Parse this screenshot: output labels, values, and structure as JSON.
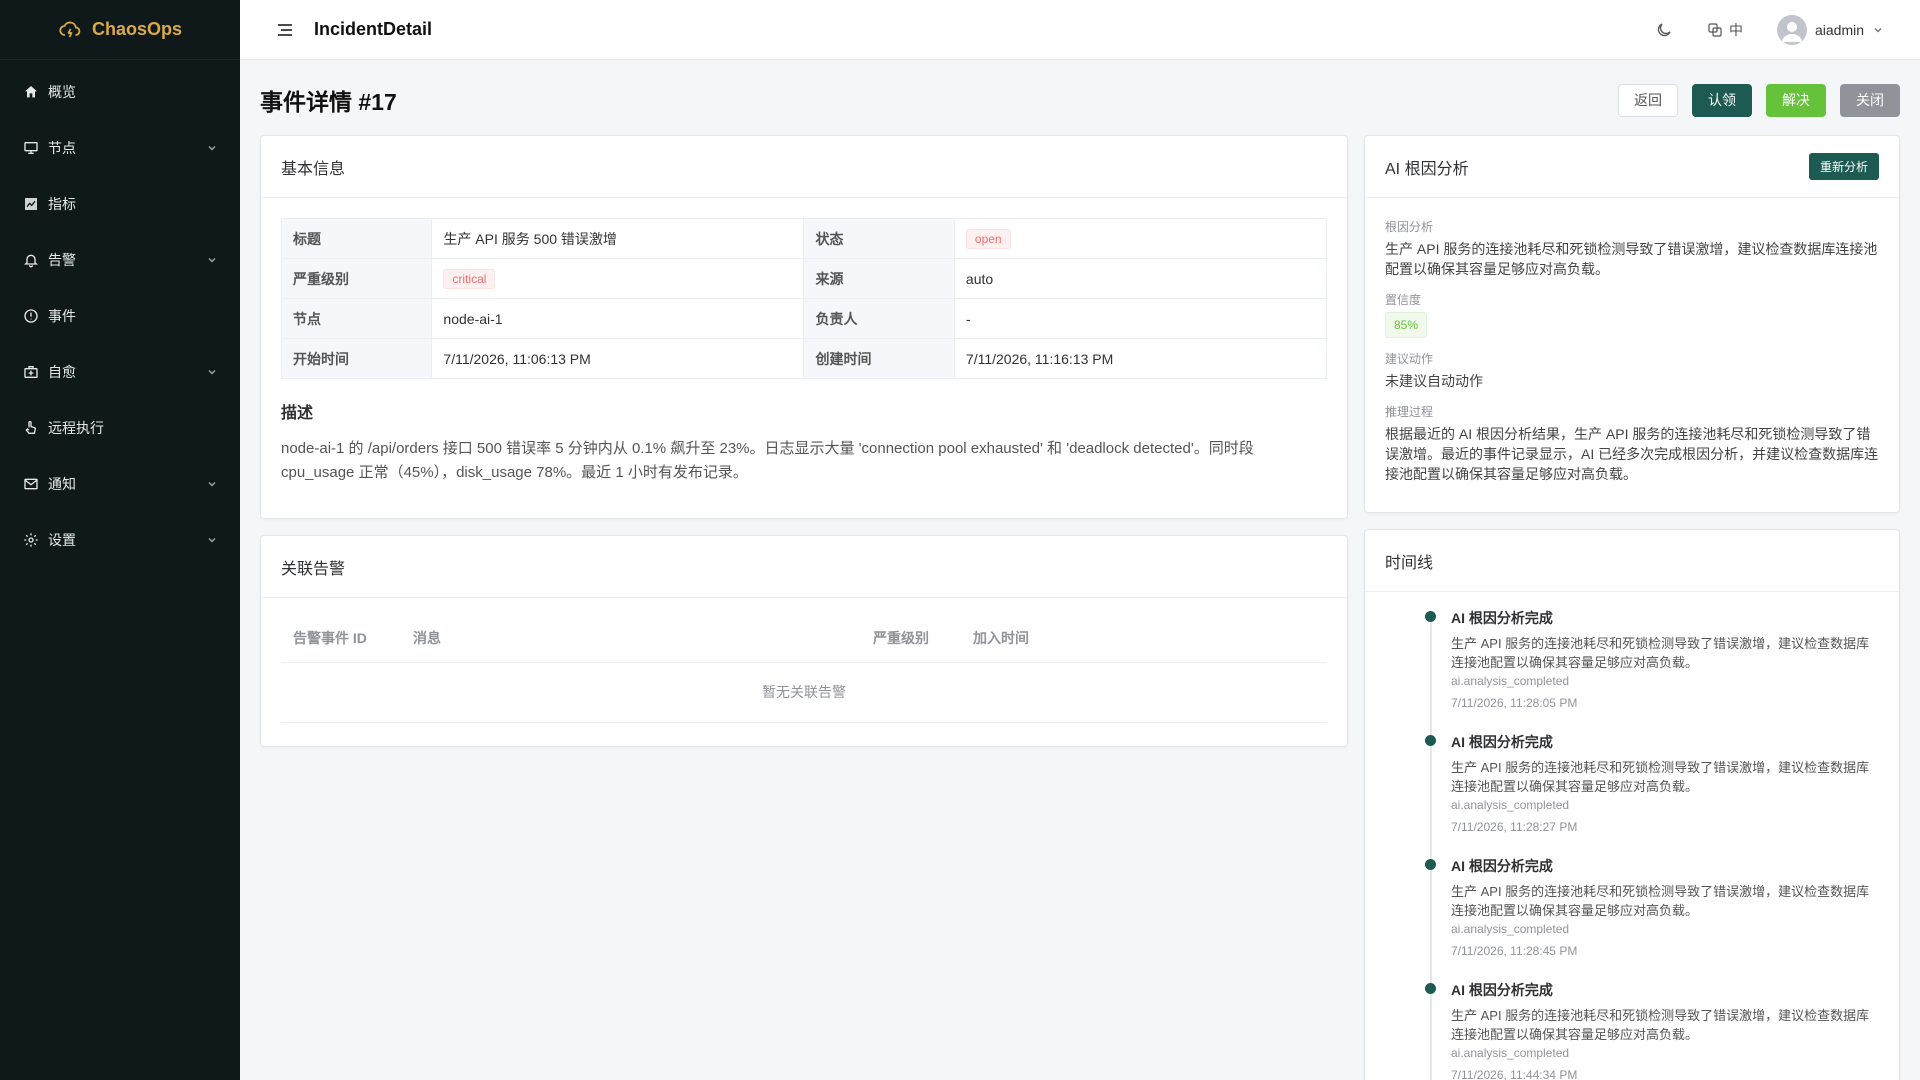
{
  "brand": {
    "name": "ChaosOps",
    "color": "#d9a94a"
  },
  "sidebar": {
    "items": [
      {
        "label": "概览",
        "icon": "home-icon",
        "has_children": false
      },
      {
        "label": "节点",
        "icon": "monitor-icon",
        "has_children": true
      },
      {
        "label": "指标",
        "icon": "chart-icon",
        "has_children": false
      },
      {
        "label": "告警",
        "icon": "bell-icon",
        "has_children": true
      },
      {
        "label": "事件",
        "icon": "alert-circle-icon",
        "has_children": false
      },
      {
        "label": "自愈",
        "icon": "medkit-icon",
        "has_children": true
      },
      {
        "label": "远程执行",
        "icon": "hand-pointer-icon",
        "has_children": false
      },
      {
        "label": "通知",
        "icon": "mail-icon",
        "has_children": true
      },
      {
        "label": "设置",
        "icon": "gear-icon",
        "has_children": true
      }
    ]
  },
  "header": {
    "title": "IncidentDetail",
    "lang": "中",
    "username": "aiadmin"
  },
  "page": {
    "title": "事件详情 #17",
    "buttons": {
      "back": "返回",
      "claim": "认领",
      "resolve": "解决",
      "close": "关闭"
    }
  },
  "basic": {
    "heading": "基本信息",
    "rows": [
      {
        "k1": "标题",
        "v1": "生产 API 服务 500 错误激增",
        "k2": "状态",
        "v2": "open"
      },
      {
        "k1": "严重级别",
        "v1": "critical",
        "k2": "来源",
        "v2": "auto"
      },
      {
        "k1": "节点",
        "v1": "node-ai-1",
        "k2": "负责人",
        "v2": "-"
      },
      {
        "k1": "开始时间",
        "v1": "7/11/2026, 11:06:13 PM",
        "k2": "创建时间",
        "v2": "7/11/2026, 11:16:13 PM"
      }
    ],
    "desc_title": "描述",
    "desc": "node-ai-1 的 /api/orders 接口 500 错误率 5 分钟内从 0.1% 飙升至 23%。日志显示大量 'connection pool exhausted' 和 'deadlock detected'。同时段 cpu_usage 正常（45%），disk_usage 78%。最近 1 小时有发布记录。"
  },
  "alerts": {
    "heading": "关联告警",
    "columns": [
      "告警事件 ID",
      "消息",
      "严重级别",
      "加入时间"
    ],
    "empty": "暂无关联告警"
  },
  "ai": {
    "heading": "AI 根因分析",
    "reanalyze": "重新分析",
    "root_cause_label": "根因分析",
    "root_cause": "生产 API 服务的连接池耗尽和死锁检测导致了错误激增，建议检查数据库连接池配置以确保其容量足够应对高负载。",
    "confidence_label": "置信度",
    "confidence": "85%",
    "action_label": "建议动作",
    "action": "未建议自动动作",
    "reasoning_label": "推理过程",
    "reasoning": "根据最近的 AI 根因分析结果，生产 API 服务的连接池耗尽和死锁检测导致了错误激增。最近的事件记录显示，AI 已经多次完成根因分析，并建议检查数据库连接池配置以确保其容量足够应对高负载。"
  },
  "timeline": {
    "heading": "时间线",
    "items": [
      {
        "title": "AI 根因分析完成",
        "text": "生产 API 服务的连接池耗尽和死锁检测导致了错误激增，建议检查数据库连接池配置以确保其容量足够应对高负载。",
        "code": "ai.analysis_completed",
        "time": "7/11/2026, 11:28:05 PM"
      },
      {
        "title": "AI 根因分析完成",
        "text": "生产 API 服务的连接池耗尽和死锁检测导致了错误激增，建议检查数据库连接池配置以确保其容量足够应对高负载。",
        "code": "ai.analysis_completed",
        "time": "7/11/2026, 11:28:27 PM"
      },
      {
        "title": "AI 根因分析完成",
        "text": "生产 API 服务的连接池耗尽和死锁检测导致了错误激增，建议检查数据库连接池配置以确保其容量足够应对高负载。",
        "code": "ai.analysis_completed",
        "time": "7/11/2026, 11:28:45 PM"
      },
      {
        "title": "AI 根因分析完成",
        "text": "生产 API 服务的连接池耗尽和死锁检测导致了错误激增，建议检查数据库连接池配置以确保其容量足够应对高负载。",
        "code": "ai.analysis_completed",
        "time": "7/11/2026, 11:44:34 PM"
      }
    ]
  },
  "colors": {
    "primary": "#1d5a52",
    "success": "#66c23a",
    "info": "#909399",
    "danger": "#f56c6c",
    "sidebar_bg": "#10191a"
  }
}
